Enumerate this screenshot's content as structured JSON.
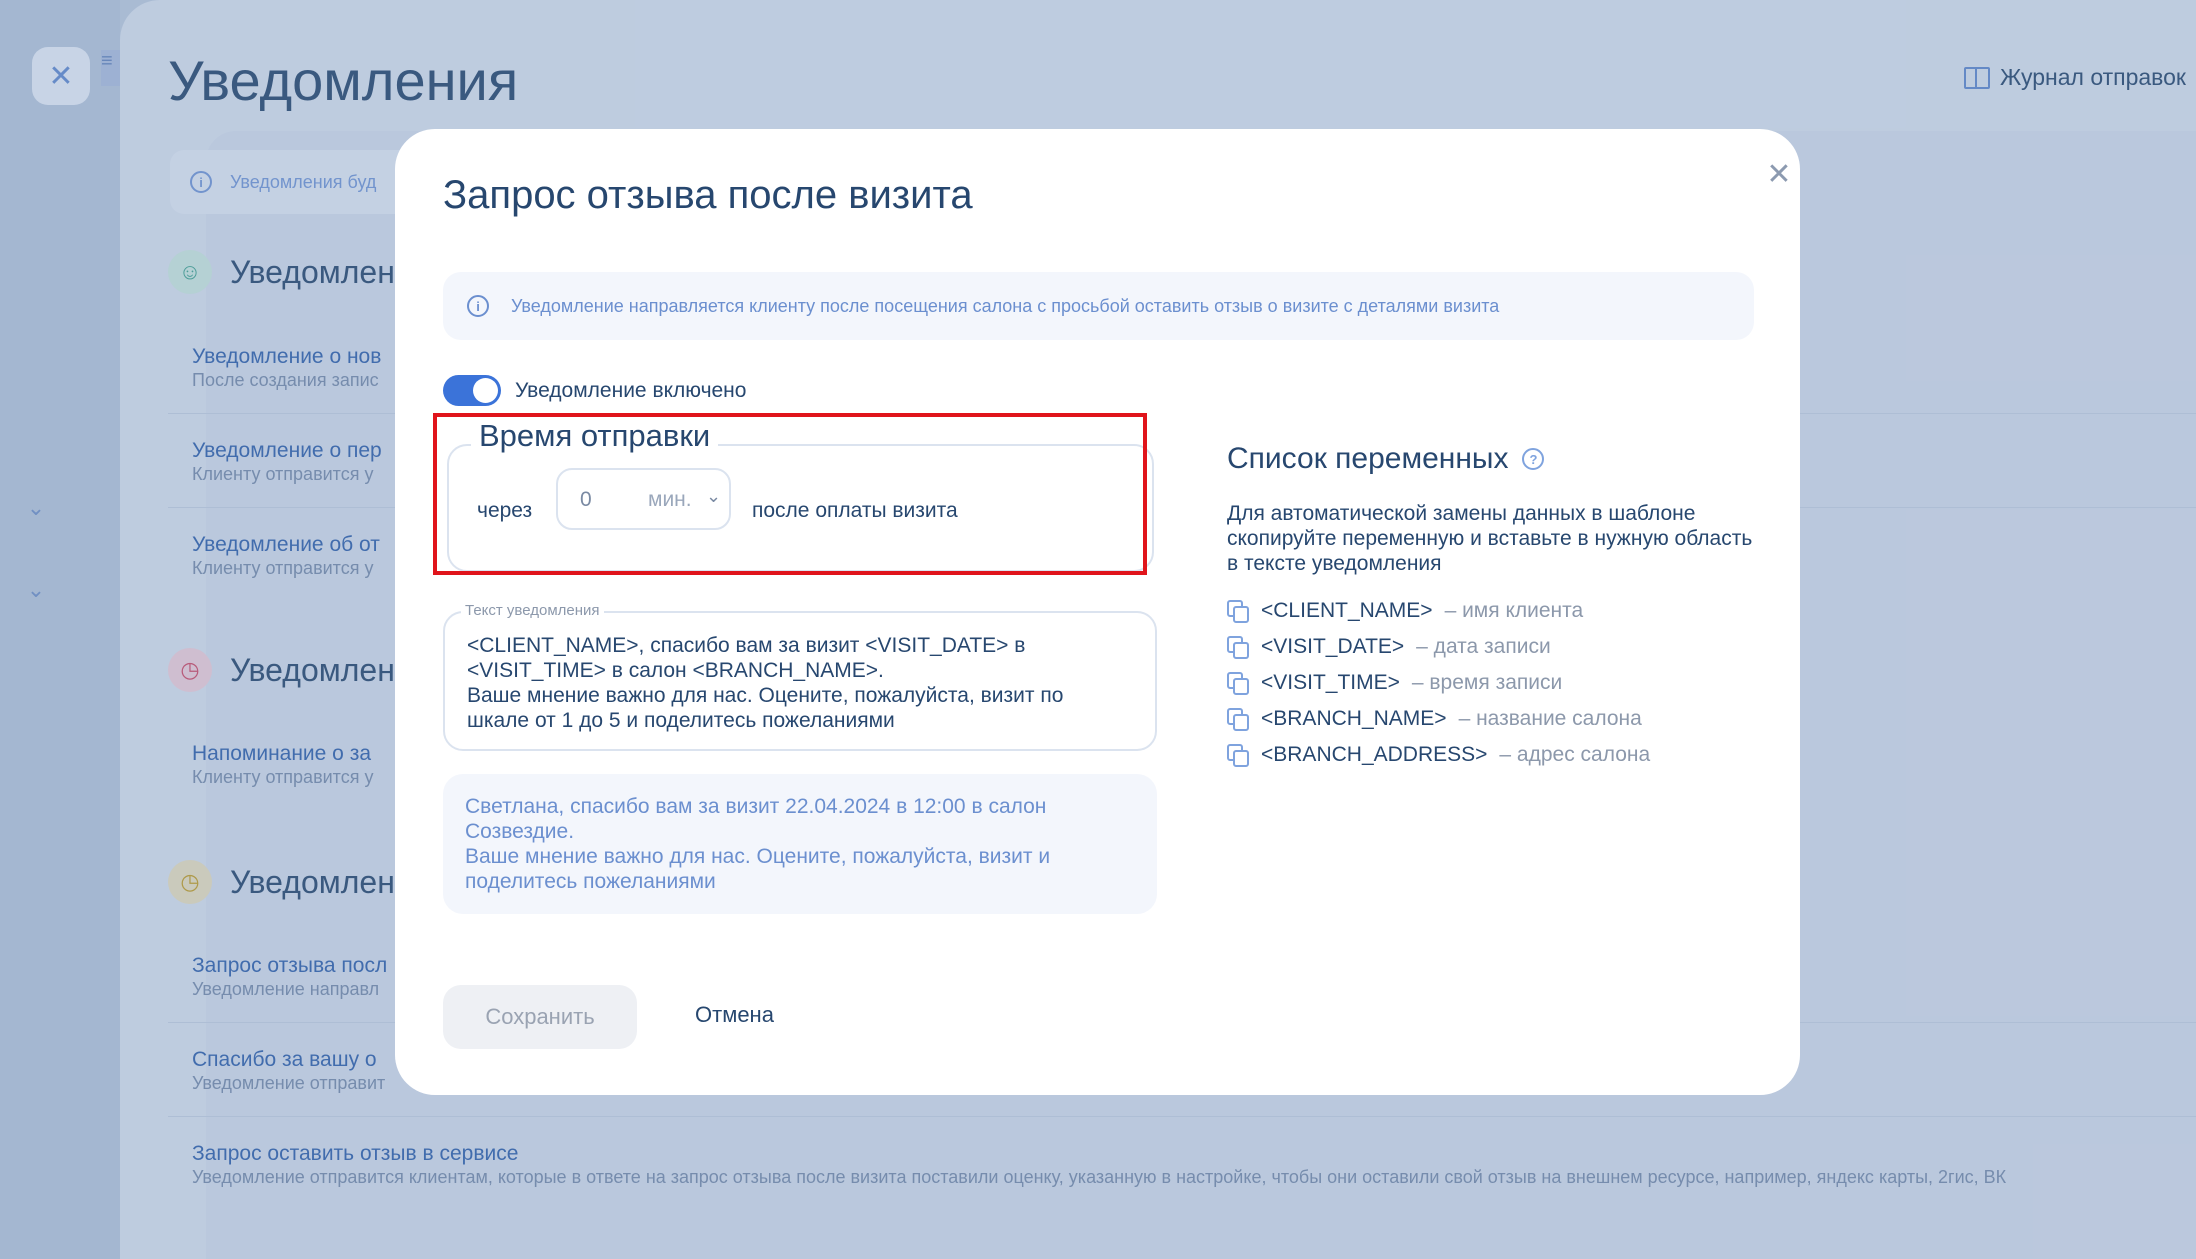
{
  "app": {
    "title": "Уведомления",
    "journal_label": "Журнал отправок",
    "info_text": "Уведомления буд",
    "sections": [
      {
        "title": "Уведомлен"
      },
      {
        "title": "Уведомлен"
      },
      {
        "title": "Уведомлен"
      }
    ],
    "rows": [
      {
        "title": "Уведомление о нов",
        "subtitle": "После создания запис"
      },
      {
        "title": "Уведомление о пер",
        "subtitle": "Клиенту отправится у"
      },
      {
        "title": "Уведомление об от",
        "subtitle": "Клиенту отправится у"
      },
      {
        "title": "Напоминание о за",
        "subtitle": "Клиенту отправится у"
      },
      {
        "title": "Запрос отзыва посл",
        "subtitle": "Уведомление направл"
      },
      {
        "title": "Спасибо за вашу о",
        "subtitle": "Уведомление отправит"
      },
      {
        "title": "Запрос оставить отзыв в сервисе",
        "subtitle": "Уведомление отправится клиентам, которые в ответе на запрос отзыва после визита поставили оценку, указанную в настройке, чтобы они оставили свой отзыв на внешнем ресурсе, например, яндекс карты, 2гис, ВК"
      }
    ]
  },
  "modal": {
    "title": "Запрос отзыва после визита",
    "info": "Уведомление направляется клиенту после посещения салона с просьбой оставить отзыв о визите с деталями визита",
    "toggle_label": "Уведомление включено",
    "toggle_on": true,
    "send_time": {
      "legend": "Время отправки",
      "prefix": "через",
      "value": "0",
      "unit": "мин.",
      "suffix": "после оплаты визита"
    },
    "textarea": {
      "label": "Текст уведомления",
      "value": "<CLIENT_NAME>, спасибо вам за визит  <VISIT_DATE> в\n<VISIT_TIME> в салон <BRANCH_NAME>.\nВаше мнение важно для нас. Оцените, пожалуйста, визит по\nшкале от 1 до 5 и поделитесь пожеланиями"
    },
    "preview": "Светлана, спасибо вам за визит  22.04.2024 в 12:00 в салон\nСозвездие.\nВаше мнение важно для нас. Оцените, пожалуйста, визит и\nподелитесь пожеланиями",
    "save_label": "Сохранить",
    "cancel_label": "Отмена",
    "variables": {
      "title": "Список переменных",
      "description": "Для автоматической замены данных в шаблоне скопируйте переменную и вставьте в нужную область в тексте уведомления",
      "items": [
        {
          "name": "<CLIENT_NAME>",
          "desc": "– имя клиента"
        },
        {
          "name": "<VISIT_DATE>",
          "desc": "– дата записи"
        },
        {
          "name": "<VISIT_TIME>",
          "desc": "– время записи"
        },
        {
          "name": "<BRANCH_NAME>",
          "desc": "– название салона"
        },
        {
          "name": "<BRANCH_ADDRESS>",
          "desc": "– адрес салона"
        }
      ]
    }
  },
  "colors": {
    "accent": "#3b73d9",
    "text_dark": "#27476f",
    "highlight": "#e0141b"
  }
}
